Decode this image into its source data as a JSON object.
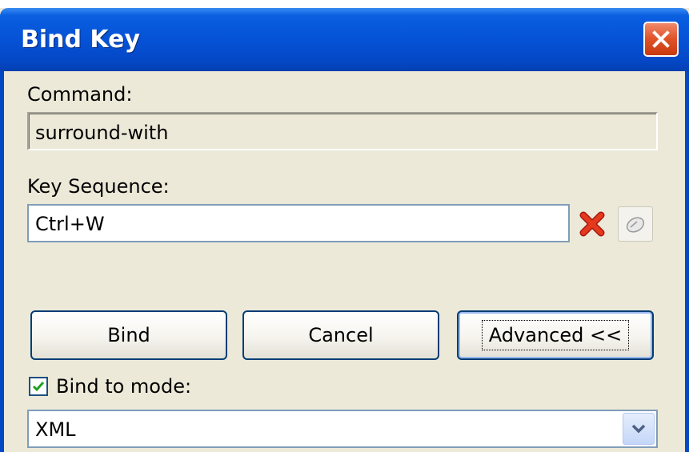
{
  "window": {
    "title": "Bind Key"
  },
  "command": {
    "label": "Command:",
    "value": "surround-with"
  },
  "key_sequence": {
    "label": "Key Sequence:",
    "value": "Ctrl+W"
  },
  "buttons": {
    "bind": "Bind",
    "cancel": "Cancel",
    "advanced": "Advanced <<"
  },
  "mode": {
    "checkbox_label": "Bind to mode:",
    "checked": true,
    "selected": "XML"
  },
  "icons": {
    "close": "close-icon",
    "clear": "red-x-icon",
    "record": "mouse-icon",
    "dropdown": "chevron-down-icon",
    "check": "check-icon"
  },
  "colors": {
    "titlebar": "#0552d6",
    "close_button": "#e2562c",
    "dialog_bg": "#ece9d8"
  }
}
